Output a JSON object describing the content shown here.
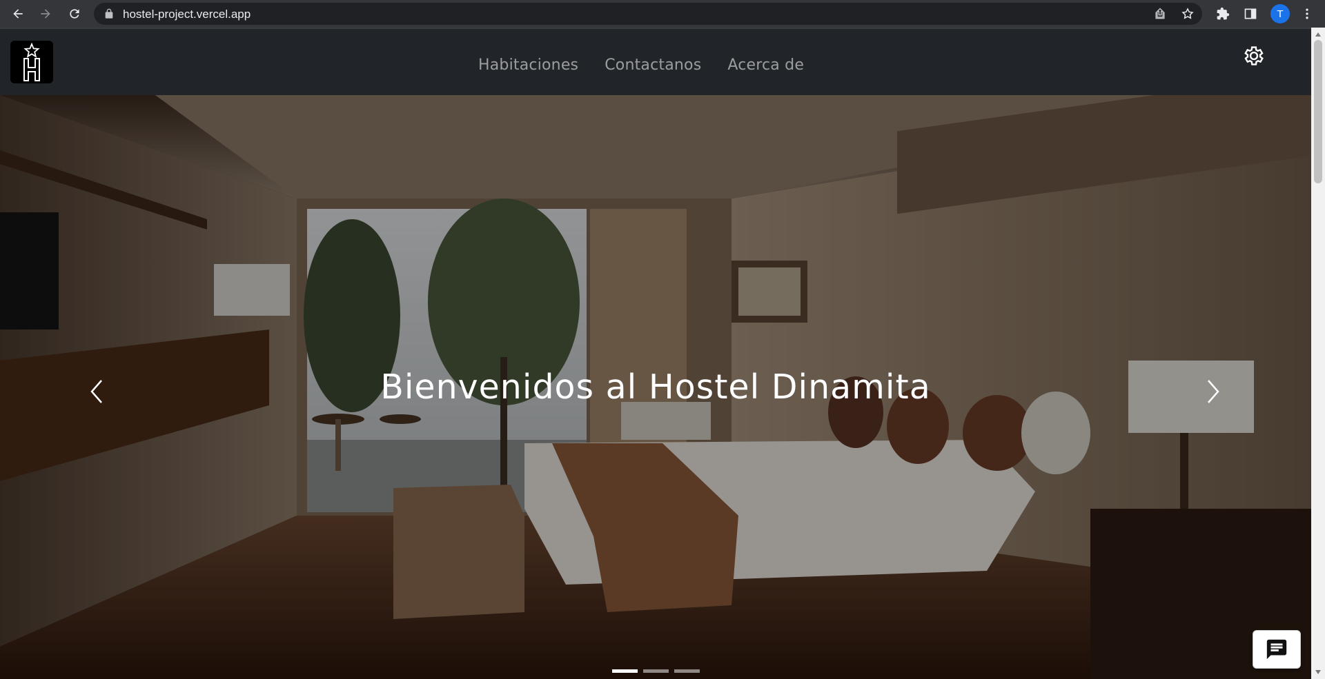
{
  "browser": {
    "url": "hostel-project.vercel.app",
    "profile_initial": "T",
    "icons": [
      "back-icon",
      "forward-icon",
      "reload-icon",
      "lock-icon",
      "share-icon",
      "bookmark-star-icon",
      "extensions-icon",
      "side-panel-icon",
      "kebab-menu-icon"
    ]
  },
  "navbar": {
    "logo_icon": "hostel-logo-star-h",
    "links": [
      "Habitaciones",
      "Contactanos",
      "Acerca de"
    ],
    "settings_icon": "gear-icon"
  },
  "carousel": {
    "caption": "Bienvenidos al Hostel Dinamita",
    "prev_icon": "chevron-left-icon",
    "next_icon": "chevron-right-icon",
    "slide_count": 3,
    "active_slide": 1
  },
  "chat": {
    "icon": "chat-icon"
  },
  "colors": {
    "navbar_bg": "#212529",
    "nav_link": "rgba(255,255,255,0.55)",
    "browser_bar": "#35363a",
    "profile_avatar": "#1a73e8"
  }
}
